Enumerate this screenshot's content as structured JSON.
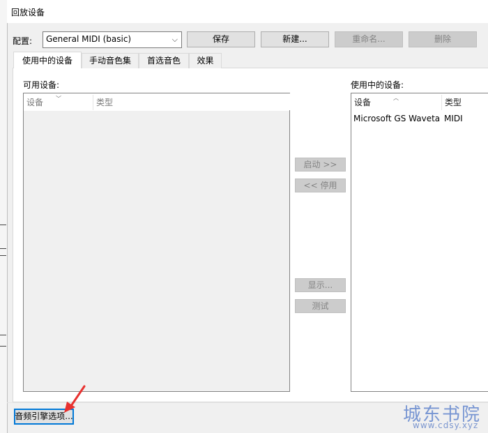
{
  "window": {
    "title": "回放设备"
  },
  "config": {
    "label": "配置:",
    "selected": "General MIDI (basic)",
    "buttons": {
      "save": "保存",
      "new": "新建...",
      "rename": "重命名...",
      "delete": "删除"
    }
  },
  "tabs": [
    {
      "label": "使用中的设备"
    },
    {
      "label": "手动音色集"
    },
    {
      "label": "首选音色"
    },
    {
      "label": "效果"
    }
  ],
  "available": {
    "label": "可用设备:",
    "columns": {
      "device": "设备",
      "type": "类型"
    }
  },
  "in_use": {
    "label": "使用中的设备:",
    "columns": {
      "device": "设备",
      "type": "类型"
    },
    "rows": [
      {
        "device": "Microsoft GS Waveta...",
        "type": "MIDI"
      }
    ]
  },
  "actions": {
    "activate": "启动 >>",
    "deactivate": "<< 停用",
    "show": "显示...",
    "test": "测试"
  },
  "footer": {
    "engine_options": "音频引擎选项..."
  },
  "watermark": {
    "text": "城东书院",
    "url": "www.cdsy.xyz"
  },
  "colors": {
    "accent": "#0078d7",
    "annotation_arrow": "#e8312f"
  }
}
